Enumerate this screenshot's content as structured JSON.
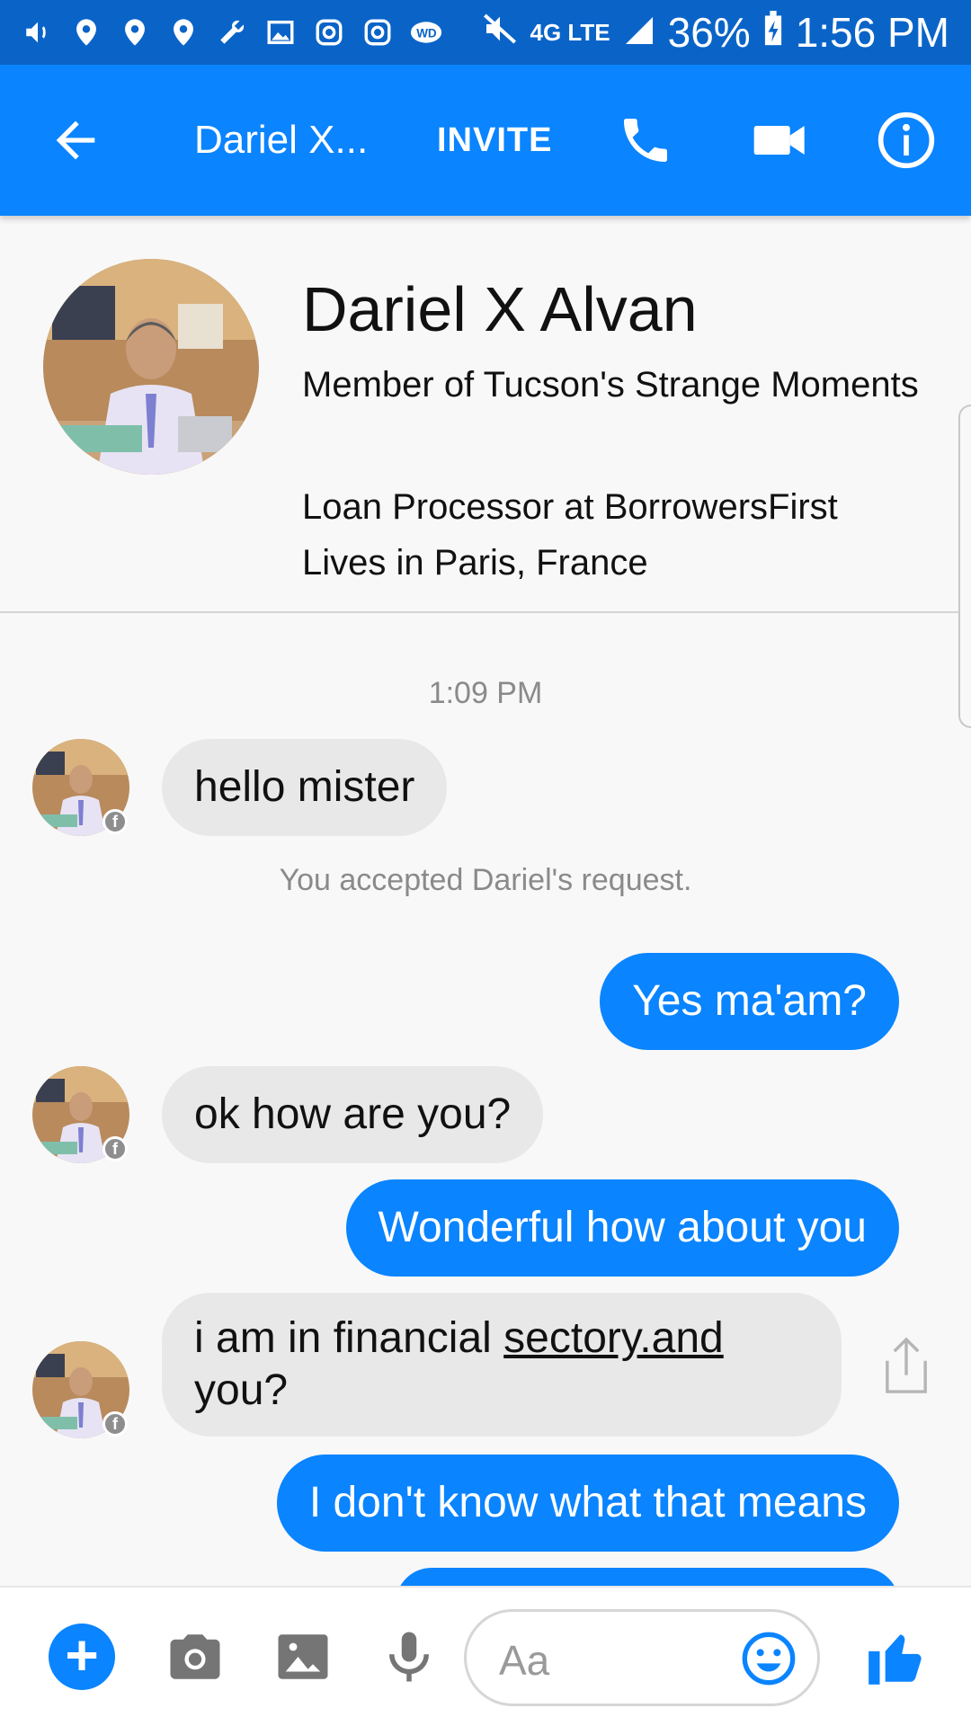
{
  "status_bar": {
    "network": "4G LTE",
    "battery": "36%",
    "time": "1:56 PM",
    "icons": [
      "volume-icon",
      "location-icon",
      "location-icon",
      "location-icon",
      "wrench-icon",
      "image-icon",
      "instagram-icon",
      "instagram-icon",
      "wd-icon"
    ]
  },
  "header": {
    "title": "Dariel X...",
    "invite_label": "INVITE"
  },
  "profile": {
    "name": "Dariel X Alvan",
    "group": "Member of Tucson's Strange Moments",
    "job": "Loan Processor at BorrowersFirst",
    "lives": "Lives in Paris, France"
  },
  "conversation": {
    "time_separator": "1:09 PM",
    "system_message": "You accepted Dariel's request.",
    "messages": [
      {
        "sender": "them",
        "text": "hello mister"
      },
      {
        "sender": "me",
        "text": "Yes ma'am?"
      },
      {
        "sender": "them",
        "text": "ok how are you?"
      },
      {
        "sender": "me",
        "text": "Wonderful how about you"
      },
      {
        "sender": "them",
        "text_before": "i am in financial ",
        "text_link": "sectory.and",
        "text_after": "you?"
      },
      {
        "sender": "me",
        "text": "I don't know what that means"
      }
    ]
  },
  "composer": {
    "placeholder": "Aa"
  },
  "colors": {
    "messenger_blue": "#0a84ff",
    "status_bar": "#0a64c8",
    "incoming_bubble": "#e8e8e8"
  }
}
